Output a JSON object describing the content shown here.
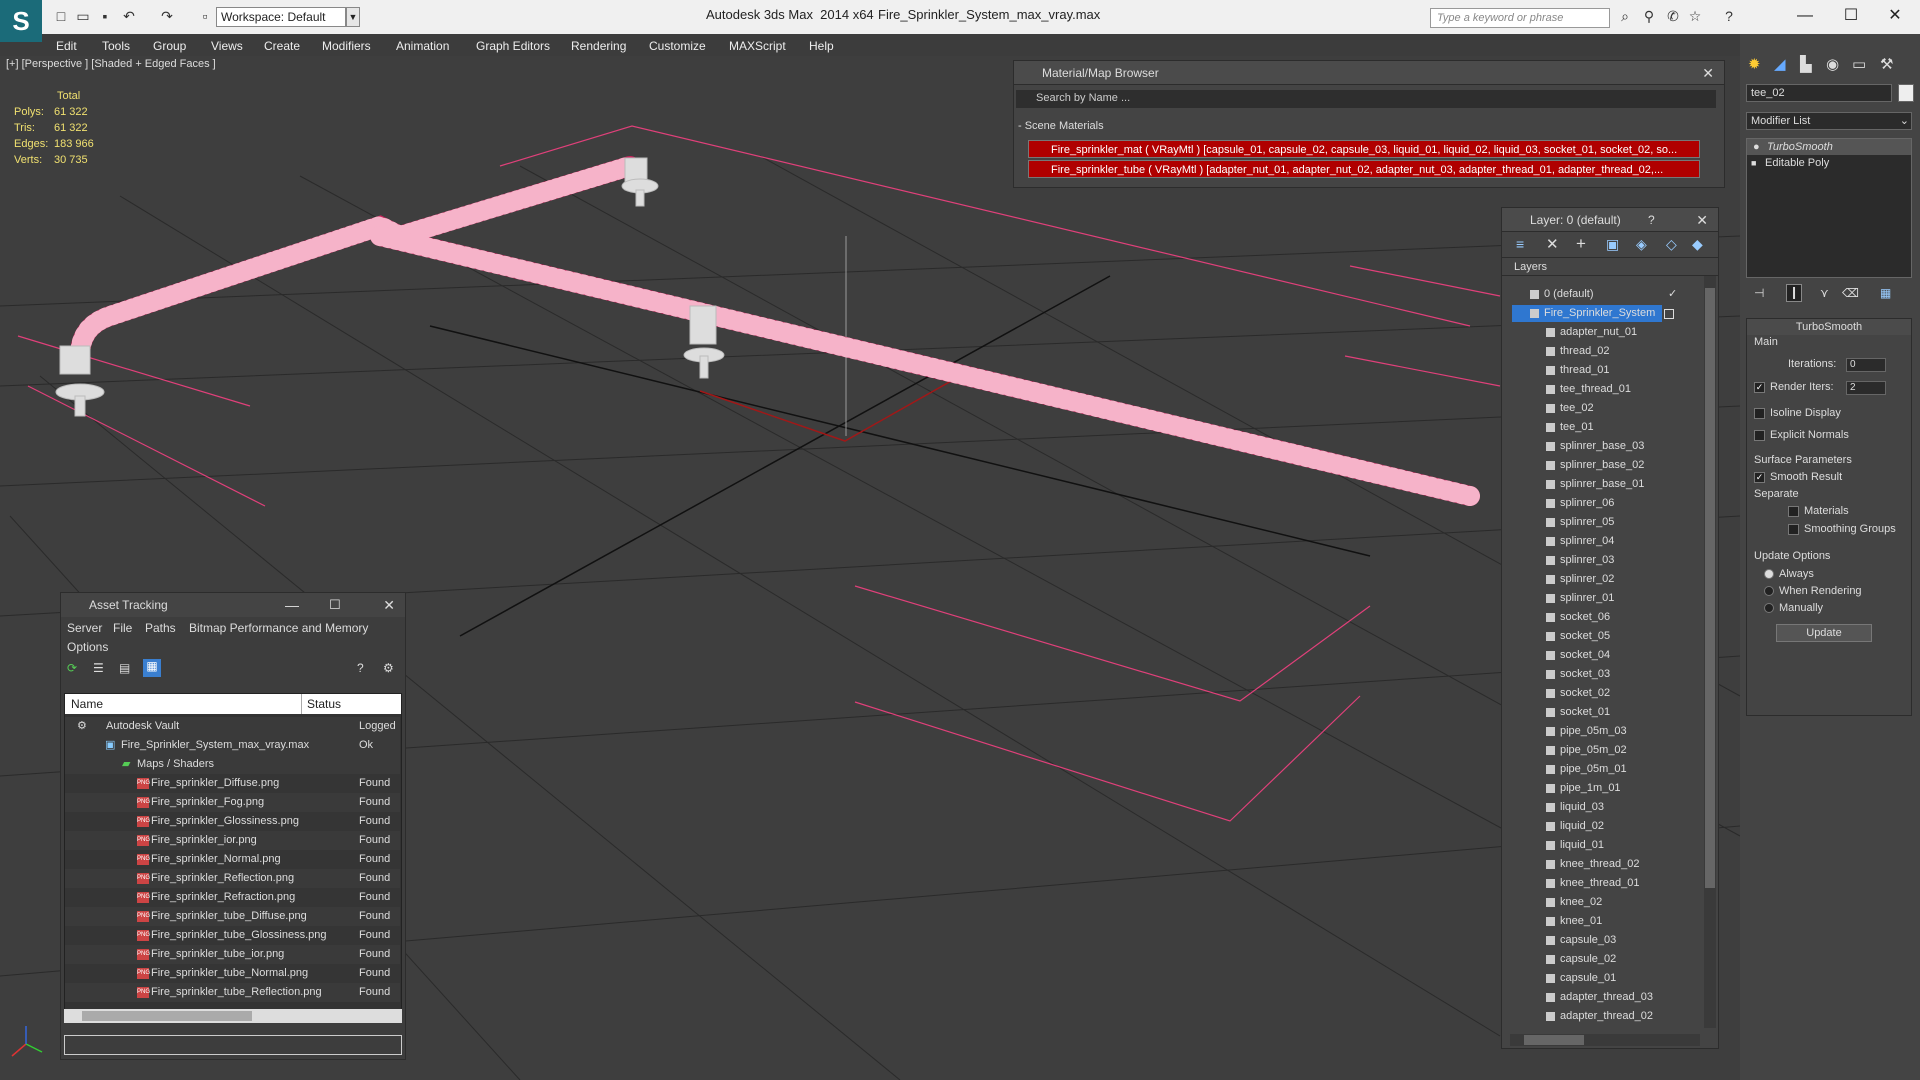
{
  "window": {
    "app_title": "Autodesk 3ds Max  2014 x64",
    "file_title": "Fire_Sprinkler_System_max_vray.max",
    "workspace": "Workspace: Default",
    "search_placeholder": "Type a keyword or phrase"
  },
  "menu": [
    "Edit",
    "Tools",
    "Group",
    "Views",
    "Create",
    "Modifiers",
    "Animation",
    "Graph Editors",
    "Rendering",
    "Customize",
    "MAXScript",
    "Help"
  ],
  "viewport": {
    "label": "[+] [Perspective ] [Shaded + Edged Faces ]",
    "stats": {
      "header": "Total",
      "rows": [
        {
          "label": "Polys:",
          "value": "61 322"
        },
        {
          "label": "Tris:",
          "value": "61 322"
        },
        {
          "label": "Edges:",
          "value": "183 966"
        },
        {
          "label": "Verts:",
          "value": "30 735"
        }
      ]
    }
  },
  "material_browser": {
    "title": "Material/Map Browser",
    "search_placeholder": "Search by Name ...",
    "section": "- Scene Materials",
    "materials": [
      "Fire_sprinkler_mat  ( VRayMtl ) [capsule_01, capsule_02, capsule_03, liquid_01, liquid_02, liquid_03, socket_01, socket_02, so...",
      "Fire_sprinkler_tube  ( VRayMtl ) [adapter_nut_01, adapter_nut_02, adapter_nut_03, adapter_thread_01, adapter_thread_02,..."
    ]
  },
  "layer_panel": {
    "title": "Layer: 0 (default)",
    "help": "?",
    "header": "Layers",
    "default_layer": "0 (default)",
    "selected_layer": "Fire_Sprinkler_System",
    "items": [
      "adapter_nut_01",
      "thread_02",
      "thread_01",
      "tee_thread_01",
      "tee_02",
      "tee_01",
      "splinrer_base_03",
      "splinrer_base_02",
      "splinrer_base_01",
      "splinrer_06",
      "splinrer_05",
      "splinrer_04",
      "splinrer_03",
      "splinrer_02",
      "splinrer_01",
      "socket_06",
      "socket_05",
      "socket_04",
      "socket_03",
      "socket_02",
      "socket_01",
      "pipe_05m_03",
      "pipe_05m_02",
      "pipe_05m_01",
      "pipe_1m_01",
      "liquid_03",
      "liquid_02",
      "liquid_01",
      "knee_thread_02",
      "knee_thread_01",
      "knee_02",
      "knee_01",
      "capsule_03",
      "capsule_02",
      "capsule_01",
      "adapter_thread_03",
      "adapter_thread_02"
    ]
  },
  "asset_tracking": {
    "title": "Asset Tracking",
    "menu": [
      "Server",
      "File",
      "Paths",
      "Bitmap Performance and Memory"
    ],
    "menu2": "Options",
    "col_name": "Name",
    "col_status": "Status",
    "vault": {
      "name": "Autodesk Vault",
      "status": "Logged"
    },
    "file": {
      "name": "Fire_Sprinkler_System_max_vray.max",
      "status": "Ok"
    },
    "folder": {
      "name": "Maps / Shaders",
      "status": ""
    },
    "maps": [
      {
        "name": "Fire_sprinkler_Diffuse.png",
        "status": "Found"
      },
      {
        "name": "Fire_sprinkler_Fog.png",
        "status": "Found"
      },
      {
        "name": "Fire_sprinkler_Glossiness.png",
        "status": "Found"
      },
      {
        "name": "Fire_sprinkler_ior.png",
        "status": "Found"
      },
      {
        "name": "Fire_sprinkler_Normal.png",
        "status": "Found"
      },
      {
        "name": "Fire_sprinkler_Reflection.png",
        "status": "Found"
      },
      {
        "name": "Fire_sprinkler_Refraction.png",
        "status": "Found"
      },
      {
        "name": "Fire_sprinkler_tube_Diffuse.png",
        "status": "Found"
      },
      {
        "name": "Fire_sprinkler_tube_Glossiness.png",
        "status": "Found"
      },
      {
        "name": "Fire_sprinkler_tube_ior.png",
        "status": "Found"
      },
      {
        "name": "Fire_sprinkler_tube_Normal.png",
        "status": "Found"
      },
      {
        "name": "Fire_sprinkler_tube_Reflection.png",
        "status": "Found"
      }
    ]
  },
  "command_panel": {
    "object_name": "tee_02",
    "modifier_list": "Modifier List",
    "stack": [
      "TurboSmooth",
      "Editable Poly"
    ],
    "rollout_title": "TurboSmooth",
    "main": "Main",
    "iterations_label": "Iterations:",
    "iterations_value": "0",
    "render_iters_label": "Render Iters:",
    "render_iters_value": "2",
    "isoline": "Isoline Display",
    "explicit": "Explicit Normals",
    "surface": "Surface Parameters",
    "smooth": "Smooth Result",
    "separate": "Separate",
    "materials": "Materials",
    "smoothing_groups": "Smoothing Groups",
    "update_options": "Update Options",
    "always": "Always",
    "when_rendering": "When Rendering",
    "manually": "Manually",
    "update": "Update"
  }
}
